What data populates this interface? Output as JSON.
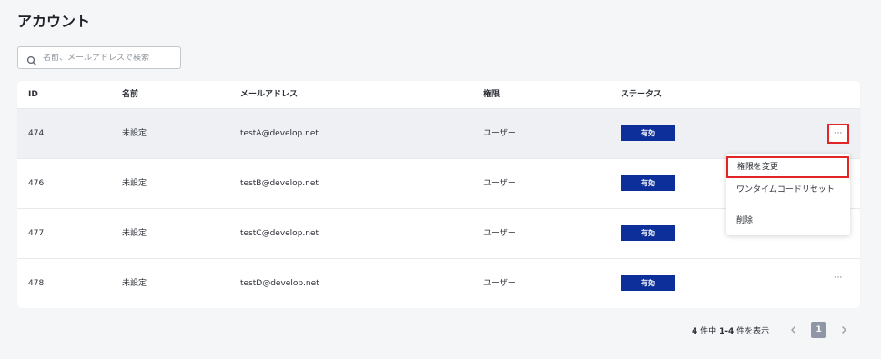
{
  "page": {
    "title": "アカウント"
  },
  "search": {
    "placeholder": "名前、メールアドレスで検索",
    "value": "",
    "icon": "search-icon"
  },
  "table": {
    "columns": [
      "ID",
      "名前",
      "メールアドレス",
      "権限",
      "ステータス"
    ],
    "rows": [
      {
        "id": "474",
        "name": "未設定",
        "email": "testA@develop.net",
        "role": "ユーザー",
        "status": "有効"
      },
      {
        "id": "476",
        "name": "未設定",
        "email": "testB@develop.net",
        "role": "ユーザー",
        "status": "有効"
      },
      {
        "id": "477",
        "name": "未設定",
        "email": "testC@develop.net",
        "role": "ユーザー",
        "status": "有効"
      },
      {
        "id": "478",
        "name": "未設定",
        "email": "testD@develop.net",
        "role": "ユーザー",
        "status": "有効"
      }
    ],
    "row_action_label": "···"
  },
  "dropdown": {
    "items": [
      {
        "label": "権限を変更"
      },
      {
        "label": "ワンタイムコードリセット"
      },
      {
        "label": "削除"
      }
    ]
  },
  "pagination": {
    "total": "4",
    "total_suffix": " 件中 ",
    "range": "1-4",
    "range_suffix": " 件を表示",
    "current_page": "1",
    "prev_icon": "chevron-left-icon",
    "next_icon": "chevron-right-icon"
  },
  "colors": {
    "badge_bg": "#0c2f9a",
    "highlight": "#e02626",
    "page_bg": "#f4f6f8"
  }
}
